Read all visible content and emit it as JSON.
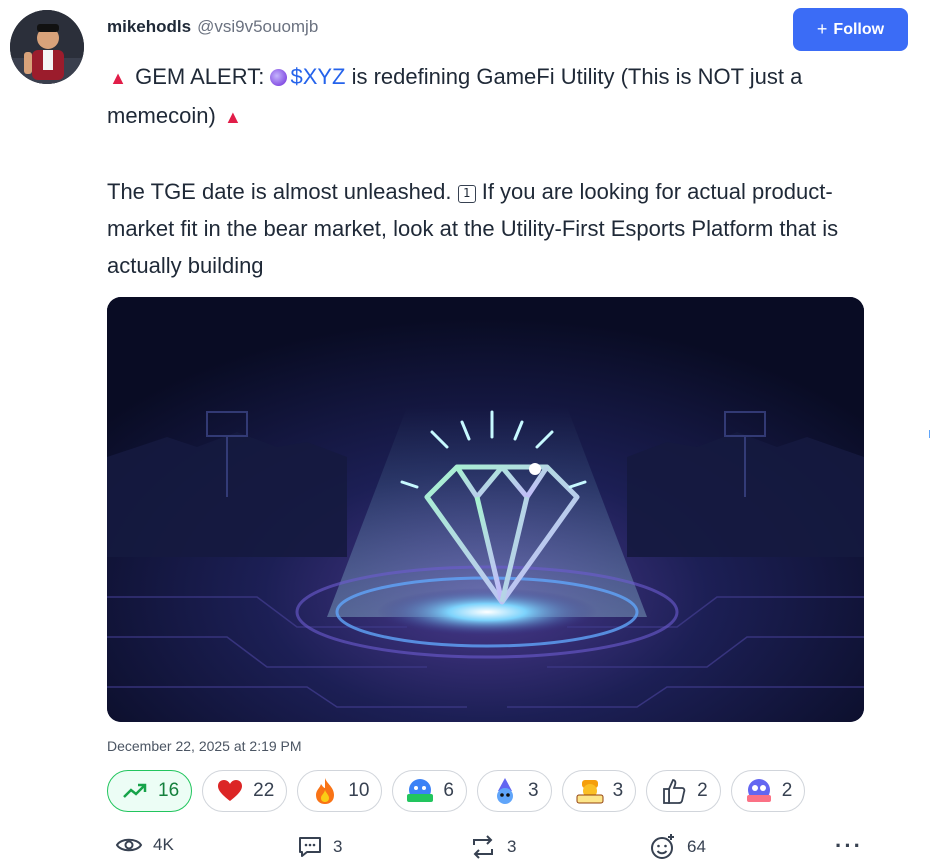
{
  "author": {
    "name": "mikehodls",
    "handle": "@vsi9v5ouomjb",
    "avatar_icon": "avatar-character-icon"
  },
  "follow": {
    "label": "Follow",
    "icon": "plus-icon",
    "color": "#3b6cf6"
  },
  "post": {
    "line1_prefix": "GEM ALERT:",
    "cashtag": "$XYZ",
    "line1_suffix": "is redefining GameFi Utility (This is NOT just a memecoin)",
    "para2_part1": "The TGE date is almost unleashed.",
    "keycap": "1",
    "para2_part2": "If you are looking for actual product-market fit in the bear market, look at the Utility-First Esports Platform that is actually building",
    "emoji": [
      "siren-emoji",
      "coin-emoji",
      "keycap-one-emoji"
    ]
  },
  "media": {
    "subject": "glowing-diamond-illustration"
  },
  "timestamp": "December 22, 2025 at 2:19 PM",
  "reactions": [
    {
      "icon": "trending-up-icon",
      "count": "16",
      "selected": true
    },
    {
      "icon": "heart-icon",
      "count": "22"
    },
    {
      "icon": "fire-icon",
      "count": "10"
    },
    {
      "icon": "hodl-sticker-icon",
      "count": "6"
    },
    {
      "icon": "wizard-sticker-icon",
      "count": "3"
    },
    {
      "icon": "buidl-sticker-icon",
      "count": "3"
    },
    {
      "icon": "thumbs-up-icon",
      "count": "2"
    },
    {
      "icon": "fomo-sticker-icon",
      "count": "2"
    }
  ],
  "actions": {
    "views": "4K",
    "comments": "3",
    "reposts": "3",
    "add_reaction": "64"
  },
  "colors": {
    "accent": "#3b6cf6",
    "trend_green": "#22c55e",
    "cashtag_blue": "#2563eb"
  }
}
